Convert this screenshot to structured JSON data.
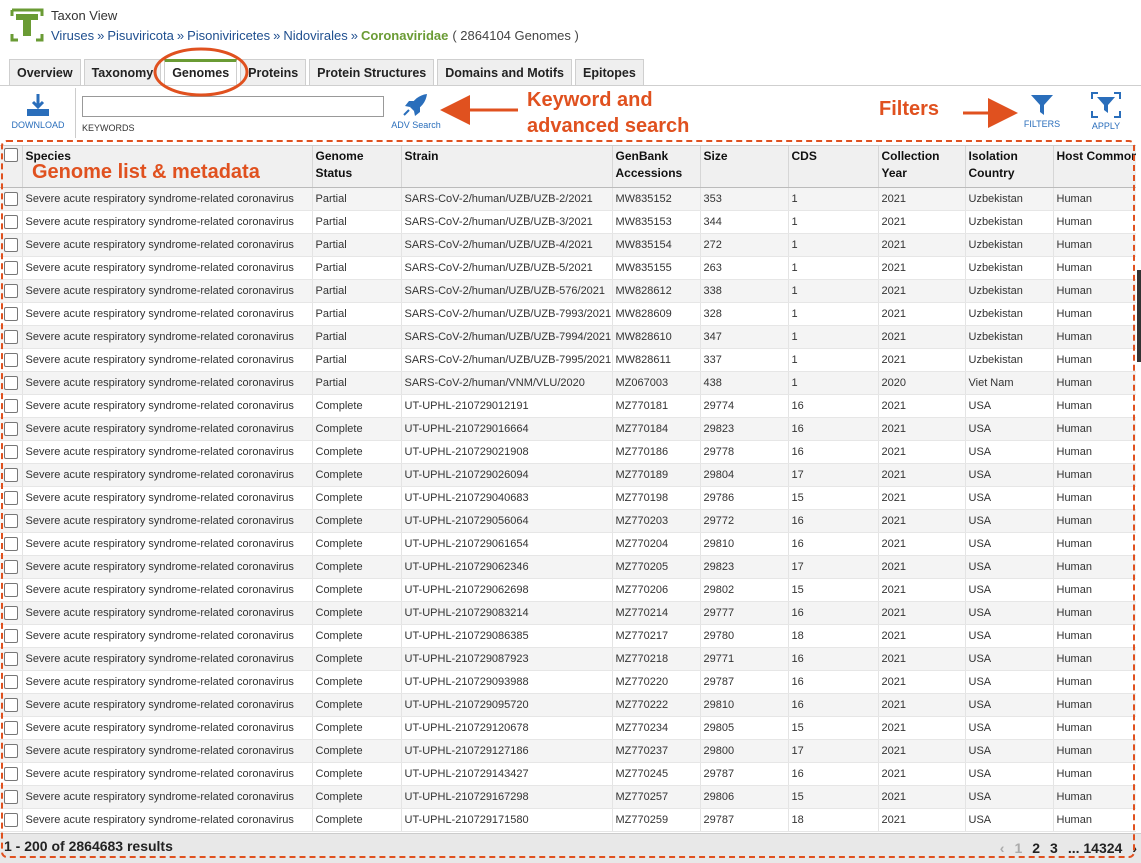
{
  "header": {
    "view_title": "Taxon View",
    "breadcrumb": [
      {
        "label": "Viruses"
      },
      {
        "label": "Pisuviricota"
      },
      {
        "label": "Pisoniviricetes"
      },
      {
        "label": "Nidovirales"
      }
    ],
    "separator": "»",
    "current": "Coronaviridae",
    "genome_count": "( 2864104 Genomes )"
  },
  "tabs": [
    {
      "label": "Overview"
    },
    {
      "label": "Taxonomy"
    },
    {
      "label": "Genomes",
      "active": true
    },
    {
      "label": "Proteins"
    },
    {
      "label": "Protein Structures"
    },
    {
      "label": "Domains and Motifs"
    },
    {
      "label": "Epitopes"
    }
  ],
  "toolbar": {
    "download_label": "DOWNLOAD",
    "keywords_value": "",
    "keywords_label": "KEYWORDS",
    "adv_search_label": "ADV Search",
    "filters_label": "FILTERS",
    "apply_label": "APPLY"
  },
  "annotations": {
    "keyword_line1": "Keyword and",
    "keyword_line2": "advanced search",
    "filters": "Filters",
    "genome_list": "Genome list & metadata",
    "color": "#e0511f"
  },
  "grid": {
    "columns": [
      "Species",
      "Genome Status",
      "Strain",
      "GenBank Accessions",
      "Size",
      "CDS",
      "Collection Year",
      "Isolation Country",
      "Host Common Name"
    ],
    "rows": [
      [
        "Severe acute respiratory syndrome-related coronavirus",
        "Partial",
        "SARS-CoV-2/human/UZB/UZB-2/2021",
        "MW835152",
        "353",
        "1",
        "2021",
        "Uzbekistan",
        "Human"
      ],
      [
        "Severe acute respiratory syndrome-related coronavirus",
        "Partial",
        "SARS-CoV-2/human/UZB/UZB-3/2021",
        "MW835153",
        "344",
        "1",
        "2021",
        "Uzbekistan",
        "Human"
      ],
      [
        "Severe acute respiratory syndrome-related coronavirus",
        "Partial",
        "SARS-CoV-2/human/UZB/UZB-4/2021",
        "MW835154",
        "272",
        "1",
        "2021",
        "Uzbekistan",
        "Human"
      ],
      [
        "Severe acute respiratory syndrome-related coronavirus",
        "Partial",
        "SARS-CoV-2/human/UZB/UZB-5/2021",
        "MW835155",
        "263",
        "1",
        "2021",
        "Uzbekistan",
        "Human"
      ],
      [
        "Severe acute respiratory syndrome-related coronavirus",
        "Partial",
        "SARS-CoV-2/human/UZB/UZB-576/2021",
        "MW828612",
        "338",
        "1",
        "2021",
        "Uzbekistan",
        "Human"
      ],
      [
        "Severe acute respiratory syndrome-related coronavirus",
        "Partial",
        "SARS-CoV-2/human/UZB/UZB-7993/2021",
        "MW828609",
        "328",
        "1",
        "2021",
        "Uzbekistan",
        "Human"
      ],
      [
        "Severe acute respiratory syndrome-related coronavirus",
        "Partial",
        "SARS-CoV-2/human/UZB/UZB-7994/2021",
        "MW828610",
        "347",
        "1",
        "2021",
        "Uzbekistan",
        "Human"
      ],
      [
        "Severe acute respiratory syndrome-related coronavirus",
        "Partial",
        "SARS-CoV-2/human/UZB/UZB-7995/2021",
        "MW828611",
        "337",
        "1",
        "2021",
        "Uzbekistan",
        "Human"
      ],
      [
        "Severe acute respiratory syndrome-related coronavirus",
        "Partial",
        "SARS-CoV-2/human/VNM/VLU/2020",
        "MZ067003",
        "438",
        "1",
        "2020",
        "Viet Nam",
        "Human"
      ],
      [
        "Severe acute respiratory syndrome-related coronavirus",
        "Complete",
        "UT-UPHL-210729012191",
        "MZ770181",
        "29774",
        "16",
        "2021",
        "USA",
        "Human"
      ],
      [
        "Severe acute respiratory syndrome-related coronavirus",
        "Complete",
        "UT-UPHL-210729016664",
        "MZ770184",
        "29823",
        "16",
        "2021",
        "USA",
        "Human"
      ],
      [
        "Severe acute respiratory syndrome-related coronavirus",
        "Complete",
        "UT-UPHL-210729021908",
        "MZ770186",
        "29778",
        "16",
        "2021",
        "USA",
        "Human"
      ],
      [
        "Severe acute respiratory syndrome-related coronavirus",
        "Complete",
        "UT-UPHL-210729026094",
        "MZ770189",
        "29804",
        "17",
        "2021",
        "USA",
        "Human"
      ],
      [
        "Severe acute respiratory syndrome-related coronavirus",
        "Complete",
        "UT-UPHL-210729040683",
        "MZ770198",
        "29786",
        "15",
        "2021",
        "USA",
        "Human"
      ],
      [
        "Severe acute respiratory syndrome-related coronavirus",
        "Complete",
        "UT-UPHL-210729056064",
        "MZ770203",
        "29772",
        "16",
        "2021",
        "USA",
        "Human"
      ],
      [
        "Severe acute respiratory syndrome-related coronavirus",
        "Complete",
        "UT-UPHL-210729061654",
        "MZ770204",
        "29810",
        "16",
        "2021",
        "USA",
        "Human"
      ],
      [
        "Severe acute respiratory syndrome-related coronavirus",
        "Complete",
        "UT-UPHL-210729062346",
        "MZ770205",
        "29823",
        "17",
        "2021",
        "USA",
        "Human"
      ],
      [
        "Severe acute respiratory syndrome-related coronavirus",
        "Complete",
        "UT-UPHL-210729062698",
        "MZ770206",
        "29802",
        "15",
        "2021",
        "USA",
        "Human"
      ],
      [
        "Severe acute respiratory syndrome-related coronavirus",
        "Complete",
        "UT-UPHL-210729083214",
        "MZ770214",
        "29777",
        "16",
        "2021",
        "USA",
        "Human"
      ],
      [
        "Severe acute respiratory syndrome-related coronavirus",
        "Complete",
        "UT-UPHL-210729086385",
        "MZ770217",
        "29780",
        "18",
        "2021",
        "USA",
        "Human"
      ],
      [
        "Severe acute respiratory syndrome-related coronavirus",
        "Complete",
        "UT-UPHL-210729087923",
        "MZ770218",
        "29771",
        "16",
        "2021",
        "USA",
        "Human"
      ],
      [
        "Severe acute respiratory syndrome-related coronavirus",
        "Complete",
        "UT-UPHL-210729093988",
        "MZ770220",
        "29787",
        "16",
        "2021",
        "USA",
        "Human"
      ],
      [
        "Severe acute respiratory syndrome-related coronavirus",
        "Complete",
        "UT-UPHL-210729095720",
        "MZ770222",
        "29810",
        "16",
        "2021",
        "USA",
        "Human"
      ],
      [
        "Severe acute respiratory syndrome-related coronavirus",
        "Complete",
        "UT-UPHL-210729120678",
        "MZ770234",
        "29805",
        "15",
        "2021",
        "USA",
        "Human"
      ],
      [
        "Severe acute respiratory syndrome-related coronavirus",
        "Complete",
        "UT-UPHL-210729127186",
        "MZ770237",
        "29800",
        "17",
        "2021",
        "USA",
        "Human"
      ],
      [
        "Severe acute respiratory syndrome-related coronavirus",
        "Complete",
        "UT-UPHL-210729143427",
        "MZ770245",
        "29787",
        "16",
        "2021",
        "USA",
        "Human"
      ],
      [
        "Severe acute respiratory syndrome-related coronavirus",
        "Complete",
        "UT-UPHL-210729167298",
        "MZ770257",
        "29806",
        "15",
        "2021",
        "USA",
        "Human"
      ],
      [
        "Severe acute respiratory syndrome-related coronavirus",
        "Complete",
        "UT-UPHL-210729171580",
        "MZ770259",
        "29787",
        "18",
        "2021",
        "USA",
        "Human"
      ]
    ]
  },
  "footer": {
    "results": "1 - 200 of 2864683 results",
    "pager": {
      "prev": "‹",
      "pages": [
        "1",
        "2",
        "3",
        "... 14324"
      ],
      "next": "›"
    }
  },
  "colors": {
    "brand_green": "#6a9b34",
    "link_blue": "#1f4f8f",
    "icon_blue": "#2a6ebb",
    "annotation": "#e0511f"
  }
}
